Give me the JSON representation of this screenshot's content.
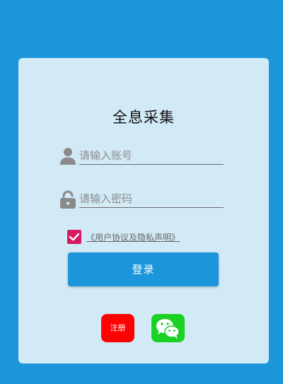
{
  "app": {
    "title": "全息采集"
  },
  "login_form": {
    "username_placeholder": "请输入账号",
    "password_placeholder": "请输入密码",
    "agreement_checked": true,
    "agreement_text": "《用户协议及隐私声明》",
    "login_label": "登录",
    "register_label": "注册"
  },
  "icons": {
    "username": "person-icon",
    "password": "lock-icon",
    "checkbox": "check-icon",
    "wechat": "wechat-icon"
  },
  "colors": {
    "page_background": "#1b96db",
    "card_background": "#d2e9f6",
    "primary": "#1b96db",
    "checkbox": "#d81b60",
    "register": "#ff0000",
    "wechat": "#1ad223"
  }
}
